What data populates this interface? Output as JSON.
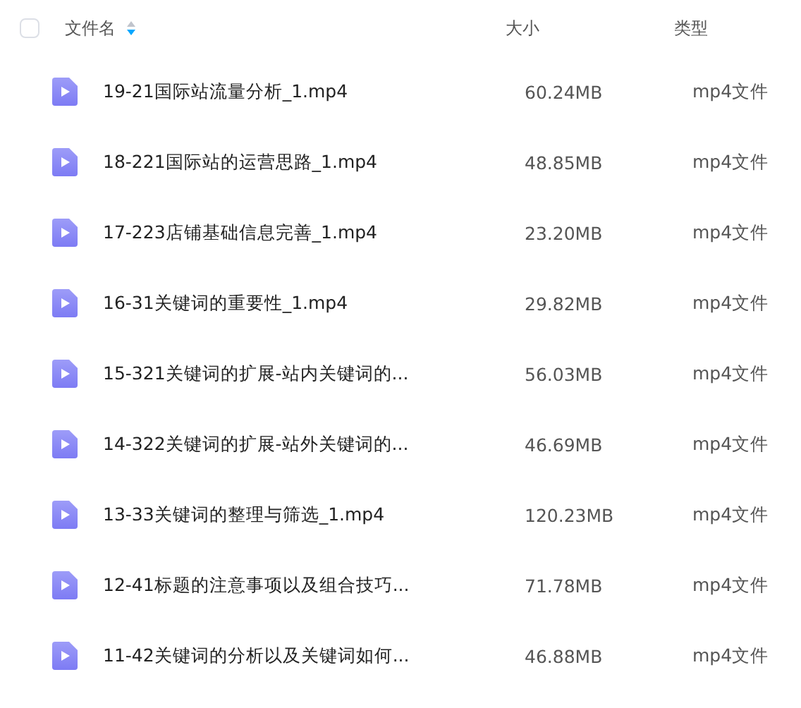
{
  "header": {
    "select_all": {
      "checked": false
    },
    "columns": [
      {
        "label": "文件名",
        "sort_descending": true
      },
      {
        "label": "大小"
      },
      {
        "label": "类型"
      }
    ]
  },
  "files": [
    {
      "name": "19-21国际站流量分析_1.mp4",
      "size": "60.24MB",
      "type": "mp4文件"
    },
    {
      "name": "18-221国际站的运营思路_1.mp4",
      "size": "48.85MB",
      "type": "mp4文件"
    },
    {
      "name": "17-223店铺基础信息完善_1.mp4",
      "size": "23.20MB",
      "type": "mp4文件"
    },
    {
      "name": "16-31关键词的重要性_1.mp4",
      "size": "29.82MB",
      "type": "mp4文件"
    },
    {
      "name": "15-321关键词的扩展-站内关键词的...",
      "size": "56.03MB",
      "type": "mp4文件"
    },
    {
      "name": "14-322关键词的扩展-站外关键词的...",
      "size": "46.69MB",
      "type": "mp4文件"
    },
    {
      "name": "13-33关键词的整理与筛选_1.mp4",
      "size": "120.23MB",
      "type": "mp4文件"
    },
    {
      "name": "12-41标题的注意事项以及组合技巧...",
      "size": "71.78MB",
      "type": "mp4文件"
    },
    {
      "name": "11-42关键词的分析以及关键词如何...",
      "size": "46.88MB",
      "type": "mp4文件"
    }
  ]
}
